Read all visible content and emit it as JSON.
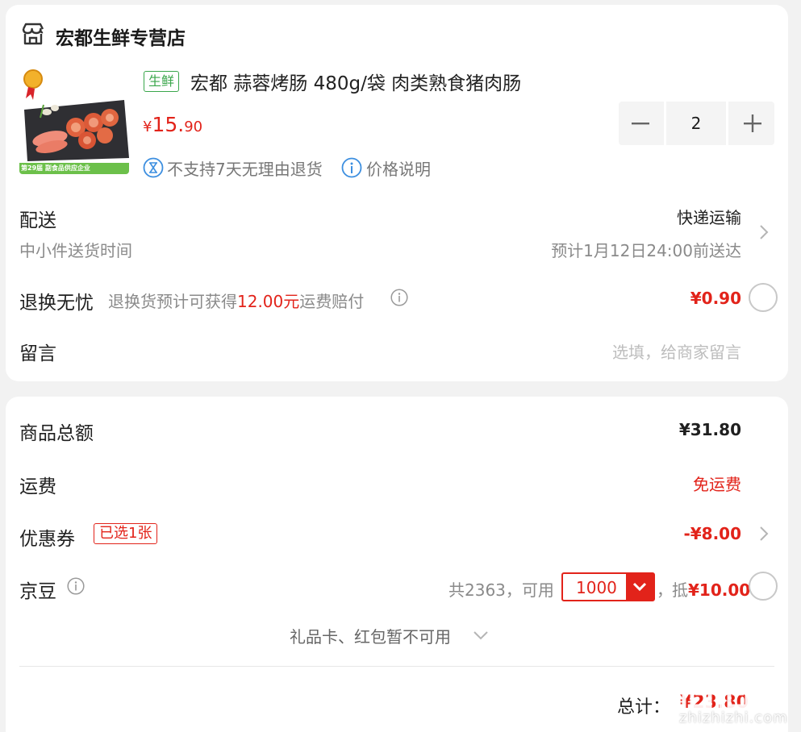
{
  "shop": {
    "name": "宏都生鲜专营店"
  },
  "product": {
    "tag": "生鲜",
    "title": "宏都 蒜蓉烤肠 480g/袋 肉类熟食猪肉肠",
    "price_symbol": "¥",
    "price_int": "15.",
    "price_dec": "90",
    "thumb_banner": "第29届  副食品供应企业",
    "no_return": "不支持7天无理由退货",
    "price_note": "价格说明",
    "quantity": "2"
  },
  "shipping": {
    "label": "配送",
    "sub": "中小件送货时间",
    "method": "快递运输",
    "eta": "预计1月12日24:00前送达"
  },
  "worry_free": {
    "label": "退换无忧",
    "desc_pre": "退换货预计可获得",
    "desc_amount": "12.00元",
    "desc_post": "运费赔付",
    "price": "¥0.90"
  },
  "message": {
    "label": "留言",
    "placeholder": "选填，给商家留言"
  },
  "summary": {
    "goods_label": "商品总额",
    "goods_value": "¥31.80",
    "freight_label": "运费",
    "freight_value": "免运费",
    "coupon_label": "优惠券",
    "coupon_tag": "已选1张",
    "coupon_value": "-¥8.00",
    "bean_label": "京豆",
    "bean_total": "共2363，可用",
    "bean_selected": "1000",
    "bean_comma": "，",
    "bean_deduct_pre": "抵",
    "bean_deduct_value": "¥10.00",
    "gift": "礼品卡、红包暂不可用",
    "total_label": "总计：",
    "total_value": "¥23.80"
  },
  "watermark": {
    "text": "zhizhizhi.com"
  },
  "colors": {
    "accent": "#e2231a",
    "fresh": "#3aa64b",
    "info": "#3d8fe0"
  }
}
